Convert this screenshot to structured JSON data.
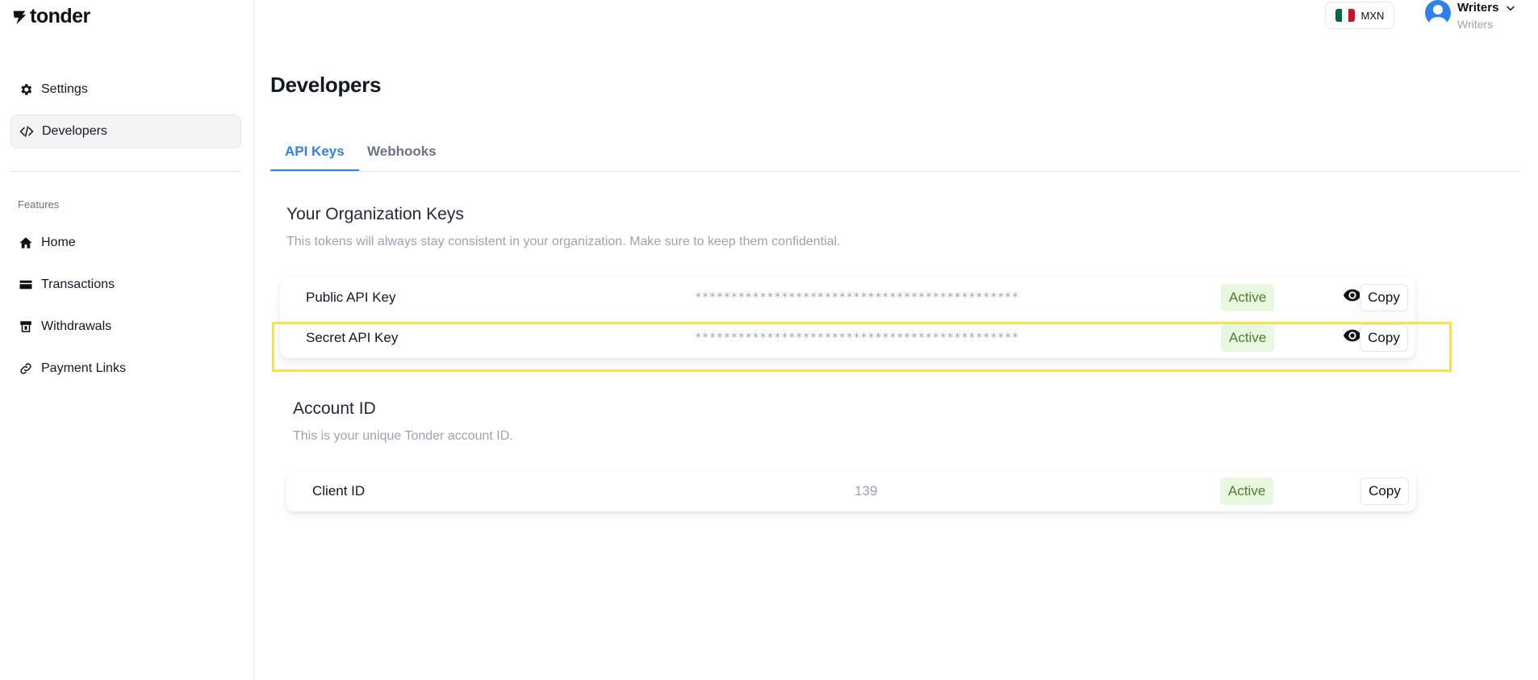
{
  "brand": {
    "logo_text": "tonder"
  },
  "sidebar": {
    "top_items": [
      {
        "label": "Settings",
        "icon": "gear-icon"
      },
      {
        "label": "Developers",
        "icon": "code-icon",
        "active": true
      }
    ],
    "section_label": "Features",
    "feature_items": [
      {
        "label": "Home",
        "icon": "home-icon"
      },
      {
        "label": "Transactions",
        "icon": "card-icon"
      },
      {
        "label": "Withdrawals",
        "icon": "withdrawal-icon"
      },
      {
        "label": "Payment Links",
        "icon": "link-icon"
      }
    ]
  },
  "header": {
    "currency": {
      "code": "MXN",
      "flag_colors": [
        "#006847",
        "#ffffff",
        "#ce1126"
      ]
    },
    "user": {
      "name": "Writers",
      "subtitle": "Writers"
    }
  },
  "page": {
    "title": "Developers",
    "tabs": [
      {
        "label": "API Keys",
        "active": true
      },
      {
        "label": "Webhooks",
        "active": false
      }
    ]
  },
  "org_keys": {
    "title": "Your Organization Keys",
    "description": "This tokens will always stay consistent in your organization. Make sure to keep them confidential.",
    "rows": [
      {
        "name": "Public API Key",
        "masked": "*********************************************",
        "status": "Active",
        "copy_label": "Copy"
      },
      {
        "name": "Secret API Key",
        "masked": "*********************************************",
        "status": "Active",
        "copy_label": "Copy"
      }
    ]
  },
  "account": {
    "title": "Account ID",
    "description": "This is your unique Tonder account ID.",
    "row": {
      "name": "Client ID",
      "value": "139",
      "status": "Active",
      "copy_label": "Copy"
    }
  },
  "colors": {
    "accent": "#2f80ed",
    "badge_bg": "#e8f7e0",
    "badge_text": "#4d7c2f",
    "highlight": "#fde047"
  }
}
